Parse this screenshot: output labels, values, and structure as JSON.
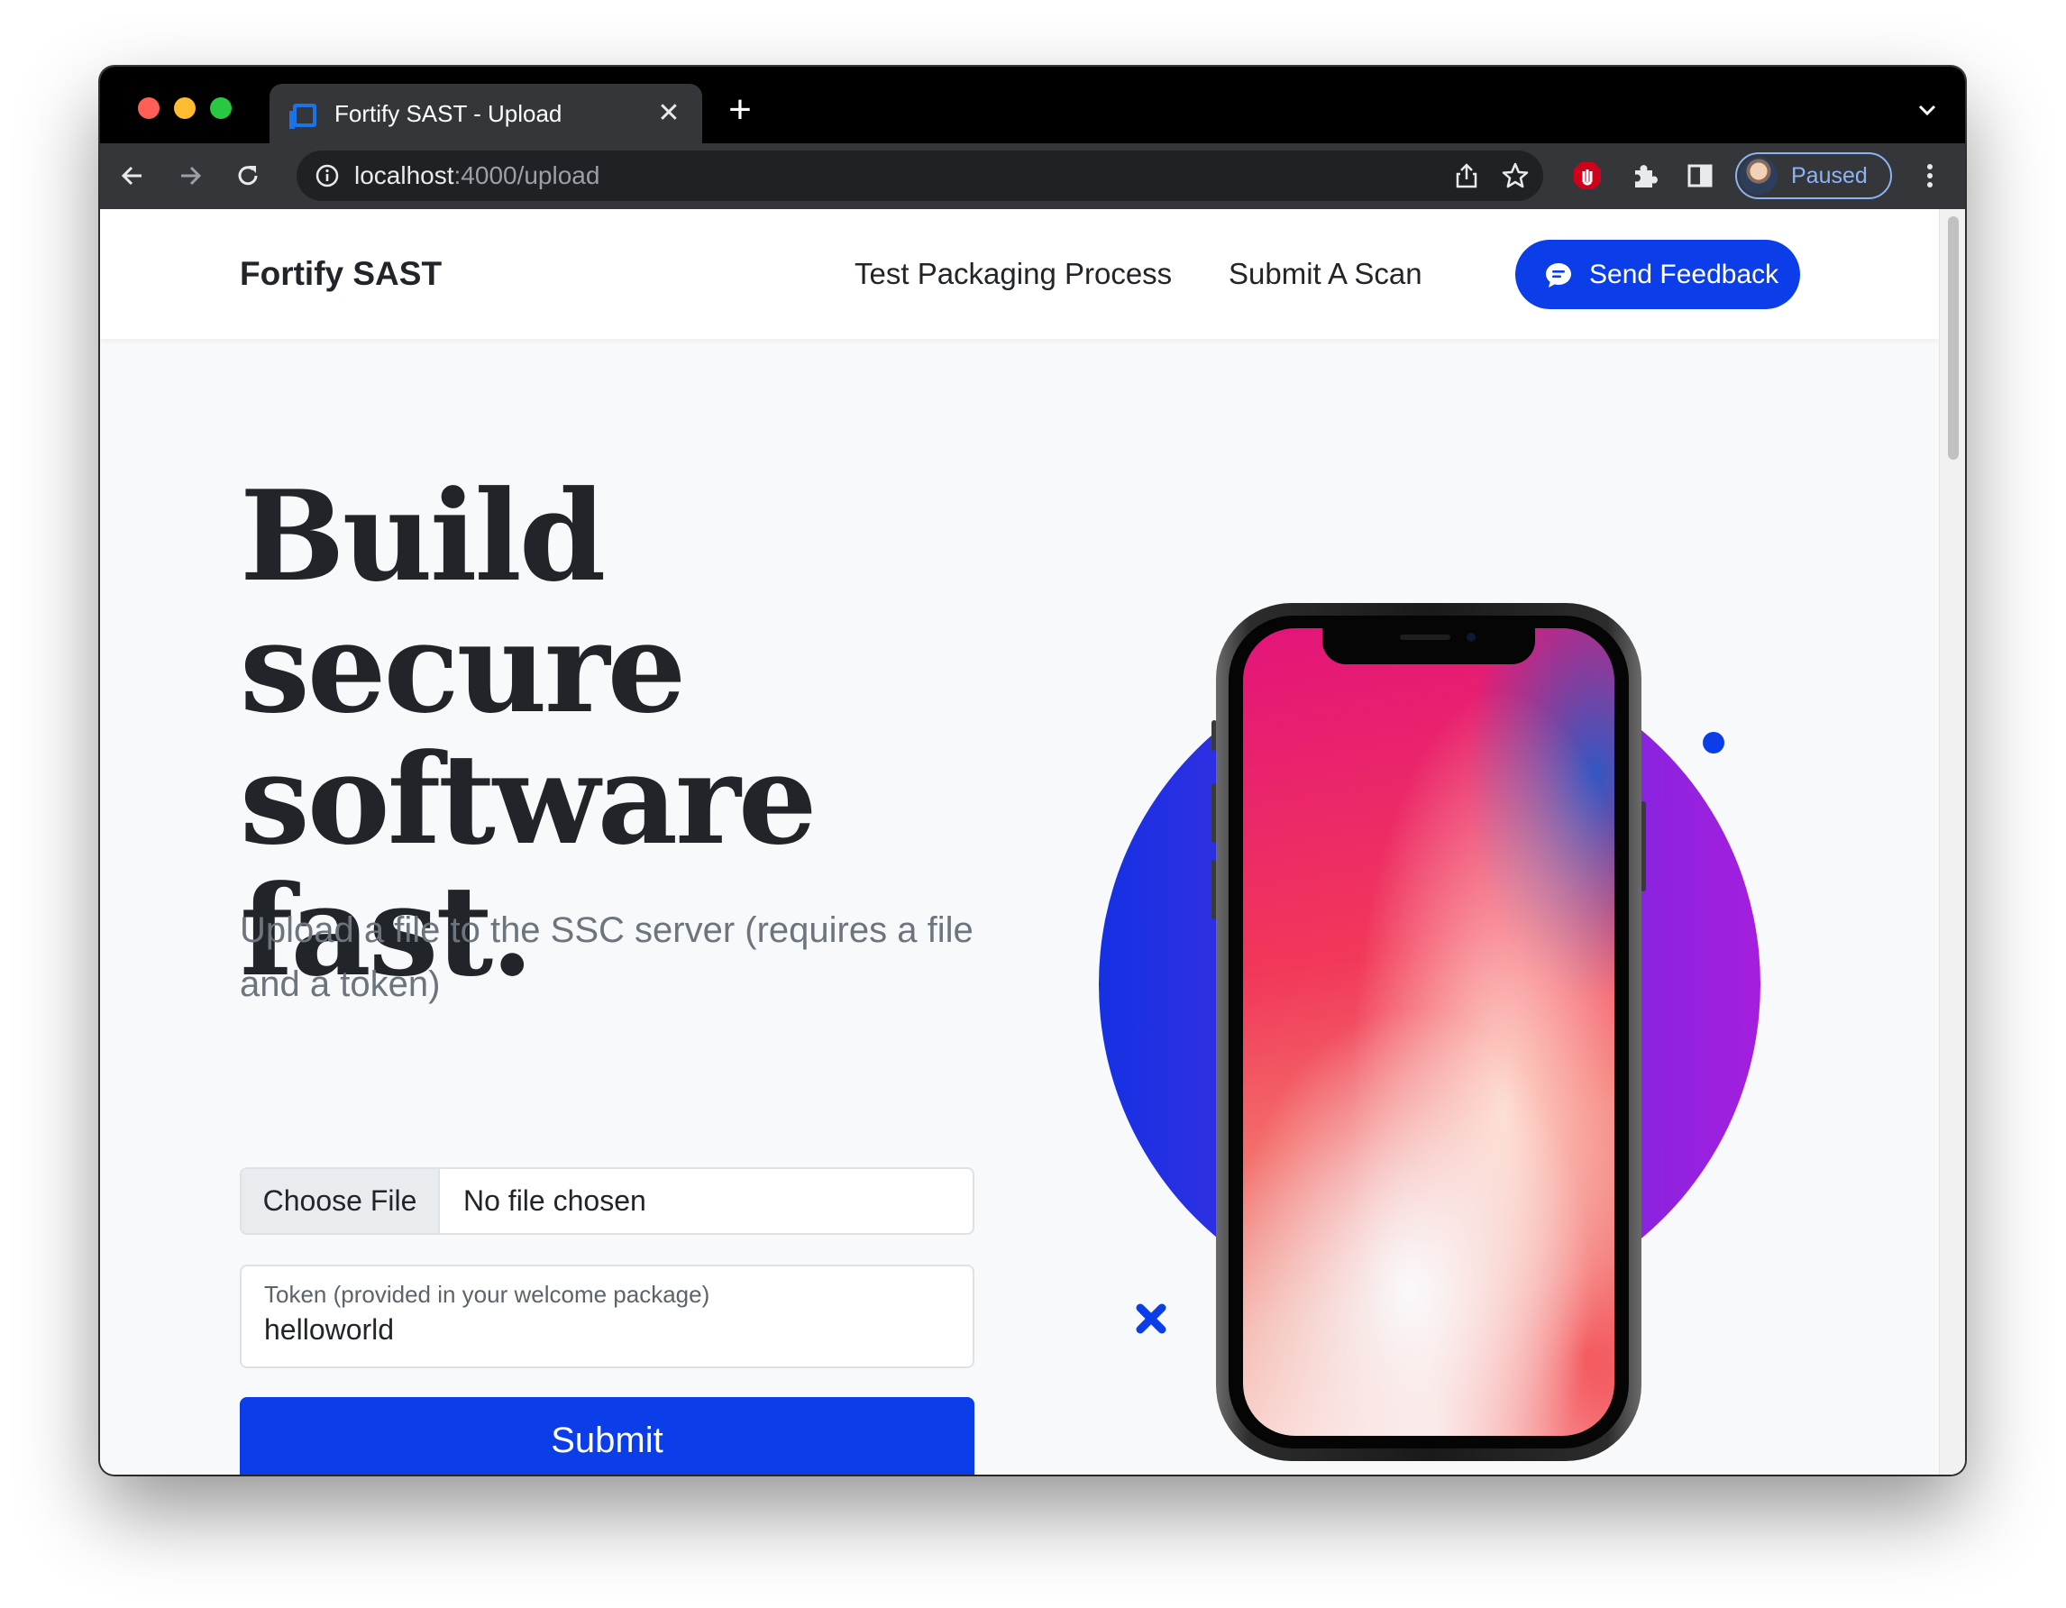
{
  "browser": {
    "tab_title": "Fortify SAST - Upload",
    "url_host": "localhost",
    "url_rest": ":4000/upload",
    "profile_status": "Paused",
    "profile_color": "#8ab4f8"
  },
  "navbar": {
    "brand": "Fortify SAST",
    "links": [
      "Test Packaging Process",
      "Submit A Scan"
    ],
    "feedback_label": "Send Feedback"
  },
  "hero": {
    "title_lines": [
      "Build secure",
      "software",
      "fast."
    ],
    "lead": "Upload a file to the SSC server (requires a file and a token)"
  },
  "form": {
    "file_button": "Choose File",
    "file_status": "No file chosen",
    "token_label": "Token (provided in your welcome package)",
    "token_value": "helloworld",
    "submit_label": "Submit"
  },
  "colors": {
    "primary": "#0b3ee8",
    "circle_gradient": [
      "#1530e3",
      "#a51ede"
    ]
  },
  "icons": [
    "back-arrow-icon",
    "forward-arrow-icon",
    "reload-icon",
    "info-icon",
    "share-icon",
    "star-icon",
    "adblock-icon",
    "extensions-icon",
    "side-panel-icon",
    "more-icon",
    "chat-bubble-icon",
    "cross-icon"
  ]
}
